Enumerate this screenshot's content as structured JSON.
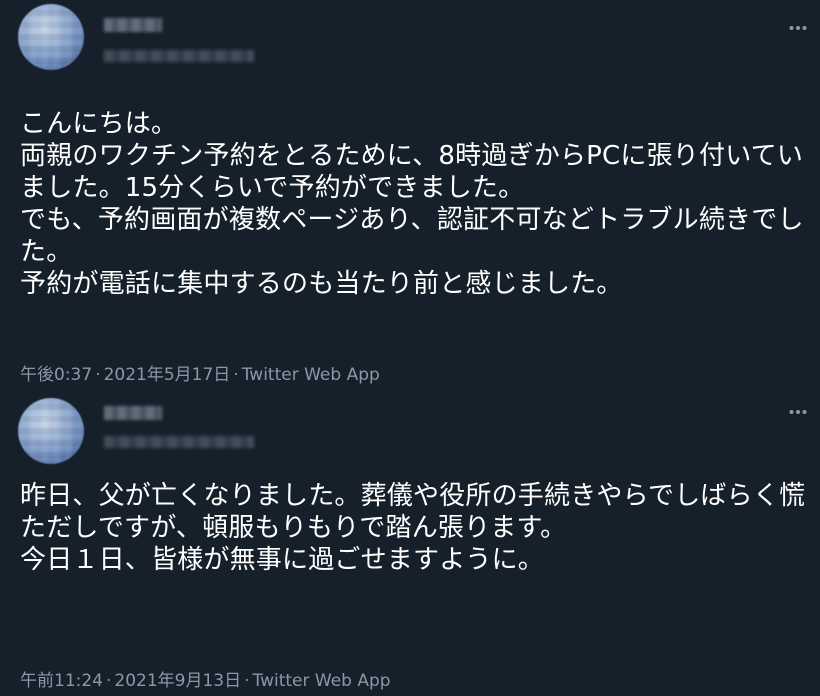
{
  "tweets": [
    {
      "text": "こんにちは。\n両親のワクチン予約をとるために、8時過ぎからPCに張り付いていました。15分くらいで予約ができました。\nでも、予約画面が複数ページあり、認証不可などトラブル続きでした。\n予約が電話に集中するのも当たり前と感じました。",
      "time": "午後0:37",
      "date": "2021年5月17日",
      "separator": "·",
      "source": "Twitter Web App"
    },
    {
      "text": "昨日、父が亡くなりました。葬儀や役所の手続きやらでしばらく慌ただしですが、頓服もりもりで踏ん張ります。\n今日１日、皆様が無事に過ごせますように。",
      "time": "午前11:24",
      "date": "2021年9月13日",
      "separator": "·",
      "source": "Twitter Web App"
    }
  ],
  "colors": {
    "background": "#15202b",
    "text": "#ffffff",
    "muted": "#8b98a5"
  },
  "icons": {
    "more": "more-horizontal-icon"
  }
}
